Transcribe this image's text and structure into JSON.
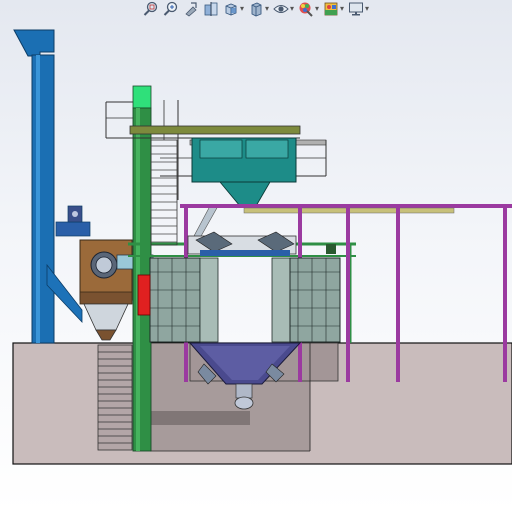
{
  "window": {
    "title": ""
  },
  "heads_up_toolbar": {
    "items": [
      {
        "name": "zoom-to-fit",
        "icon": "zoom-to-fit-icon",
        "has_dropdown": false
      },
      {
        "name": "zoom-to-area",
        "icon": "zoom-to-area-icon",
        "has_dropdown": false
      },
      {
        "name": "previous-view",
        "icon": "previous-view-icon",
        "has_dropdown": false
      },
      {
        "name": "section-view",
        "icon": "section-view-icon",
        "has_dropdown": false
      },
      {
        "name": "view-orientation",
        "icon": "view-orientation-icon",
        "has_dropdown": true
      },
      {
        "name": "display-style",
        "icon": "display-style-icon",
        "has_dropdown": true
      },
      {
        "name": "hide-show-items",
        "icon": "hide-show-eye-icon",
        "has_dropdown": true
      },
      {
        "name": "edit-appearance",
        "icon": "edit-appearance-icon",
        "has_dropdown": true
      },
      {
        "name": "apply-scene",
        "icon": "apply-scene-icon",
        "has_dropdown": true
      },
      {
        "name": "view-settings",
        "icon": "monitor-icon",
        "has_dropdown": true
      }
    ],
    "dropdown_glyph": "▾"
  },
  "viewport": {
    "background_top": "#e4e8f0",
    "background_bottom": "#ffffff",
    "model": {
      "type": "3d-cad-assembly",
      "subject": "shot-blasting-machine",
      "colors": {
        "elevator_blue": "#1b6fb3",
        "frame_green": "#2f8f45",
        "walkway_olive": "#7d8a3d",
        "hopper_teal": "#1d8c88",
        "cabinet_grey": "#8fa6a0",
        "purple_frame": "#9b3aa0",
        "separator_brown": "#9b6a3a",
        "door_red": "#e02020",
        "pit_fill": "#c9bcbc",
        "pit_dark": "#8b7f80",
        "funnel_indigo": "#4a4a8e"
      }
    }
  }
}
